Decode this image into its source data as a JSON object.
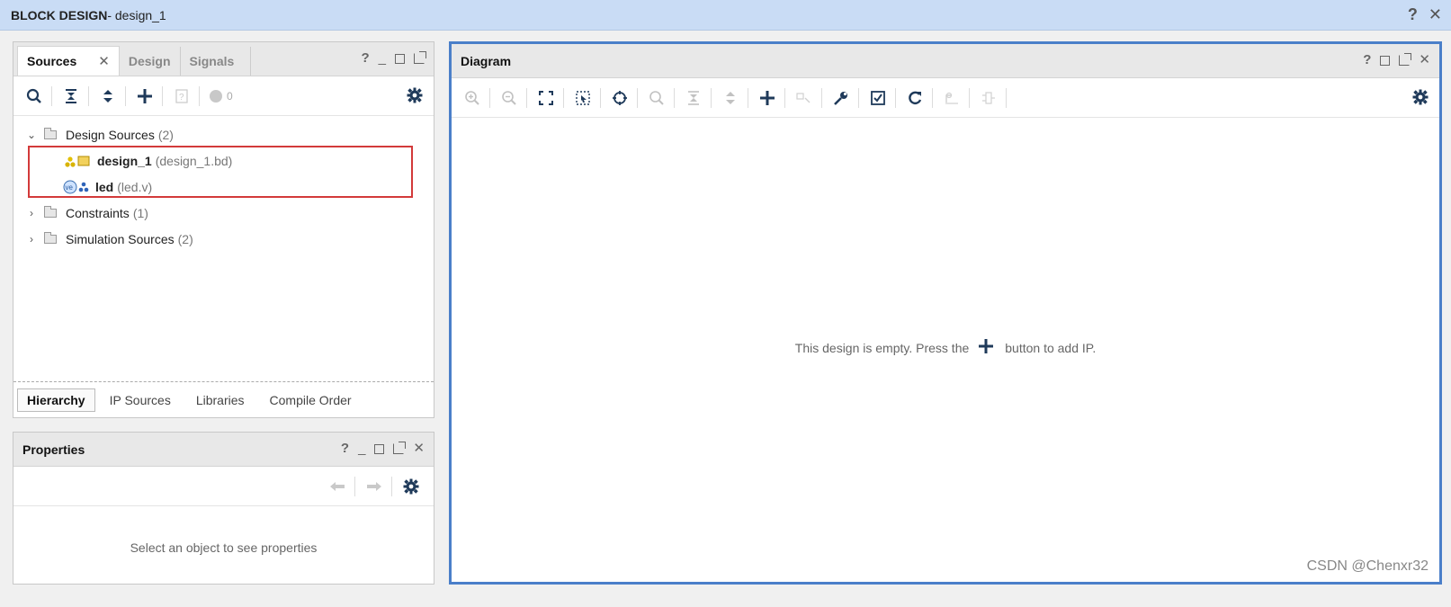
{
  "window": {
    "title_strong": "BLOCK DESIGN",
    "title_rest": " - design_1",
    "help_glyph": "?",
    "close_glyph": "✕"
  },
  "sources": {
    "tabs": [
      {
        "label": "Sources",
        "active": true
      },
      {
        "label": "Design",
        "active": false
      },
      {
        "label": "Signals",
        "active": false
      }
    ],
    "tab_close_glyph": "✕",
    "header_icons": [
      "?",
      "_"
    ],
    "status_count": "0",
    "tree": {
      "design_sources": {
        "label": "Design Sources",
        "count": "(2)"
      },
      "design_1": {
        "label": "design_1",
        "detail": "(design_1.bd)"
      },
      "led": {
        "label": "led",
        "detail": "(led.v)"
      },
      "constraints": {
        "label": "Constraints",
        "count": "(1)"
      },
      "simulation": {
        "label": "Simulation Sources",
        "count": "(2)"
      }
    },
    "bottom_tabs": [
      "Hierarchy",
      "IP Sources",
      "Libraries",
      "Compile Order"
    ],
    "highlight_color": "#d33a3a"
  },
  "properties": {
    "title": "Properties",
    "header_icons": [
      "?",
      "_",
      "✕"
    ],
    "empty_message": "Select an object to see properties"
  },
  "diagram": {
    "title": "Diagram",
    "header_icons": [
      "?",
      "✕"
    ],
    "empty_message_before": "This design is empty. Press the",
    "empty_message_after": "button to add IP.",
    "border_color": "#4a7fc9"
  },
  "watermark": "CSDN @Chenxr32"
}
